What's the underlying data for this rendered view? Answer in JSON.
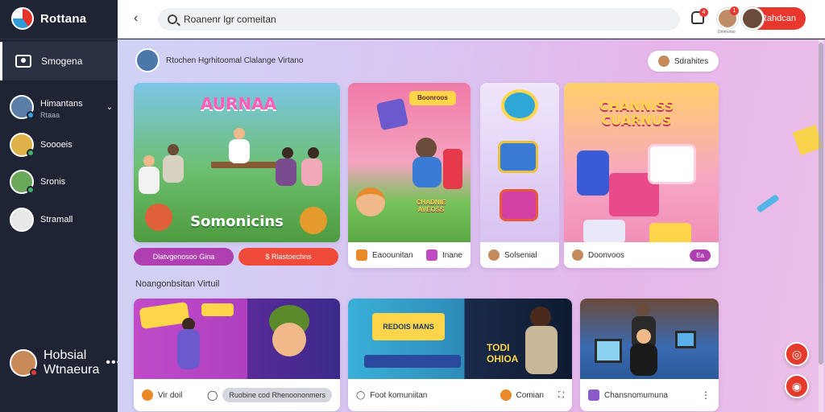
{
  "app": {
    "title": "Rottana"
  },
  "sidebar": {
    "active": {
      "label": "Smogena",
      "icon": "camera-icon"
    },
    "items": [
      {
        "label": "Himantans",
        "sub": "Rtaaa",
        "color": "#5a7ea8",
        "dot": "#35a0e0"
      },
      {
        "label": "Soooeis",
        "sub": "",
        "color": "#e0b24a",
        "dot": "#43b069"
      },
      {
        "label": "Sronis",
        "sub": "",
        "color": "#6aa85a",
        "dot": "#43b069"
      },
      {
        "label": "Stramall",
        "sub": "",
        "color": "#e8e8e8",
        "dot": ""
      }
    ],
    "footer": {
      "name": "Hobsial",
      "sub": "Wtnaeura",
      "more": "•••"
    }
  },
  "topbar": {
    "back": "‹",
    "search_value": "Roanenr lgr comeitan",
    "search_placeholder": "Search",
    "notif_count": "4",
    "avatar_count": "1",
    "avatar_caption": "Dmmonto",
    "profile_label": "Rahdcan"
  },
  "main": {
    "welcome": "Rtochen Hgrhitoomal Clalange Virtano",
    "action_label": "Sdrahites",
    "featured": {
      "title": "AURNAA",
      "caption": "Somonicins",
      "btn1": "Dlatvgenosoo Gina",
      "btn2": "$ Rlastoechns"
    },
    "cards": [
      {
        "banner": "Boonroos",
        "label": "CHADNIE AVEOSS",
        "footer": "Eaoounitan",
        "footer2": "Inane"
      },
      {
        "banner": "",
        "label": "",
        "footer": "Solsenial"
      },
      {
        "banner": "CHANNISS CUARNUS",
        "footer": "Doonvoos",
        "tag": "Ea"
      }
    ],
    "section_title": "Noangonbsitan Virtuil",
    "bottom": [
      {
        "footer": "Vir doil",
        "footer2": "Ruobine cod Rhenoononmers"
      },
      {
        "footer": "Foot komuniitan",
        "footer2": "Comian",
        "overlay": "TODI OHIOA",
        "banner": "REDOIS MANS"
      },
      {
        "footer": "Chansnomumuna"
      }
    ],
    "fab1": "◎",
    "fab2": "◉"
  }
}
